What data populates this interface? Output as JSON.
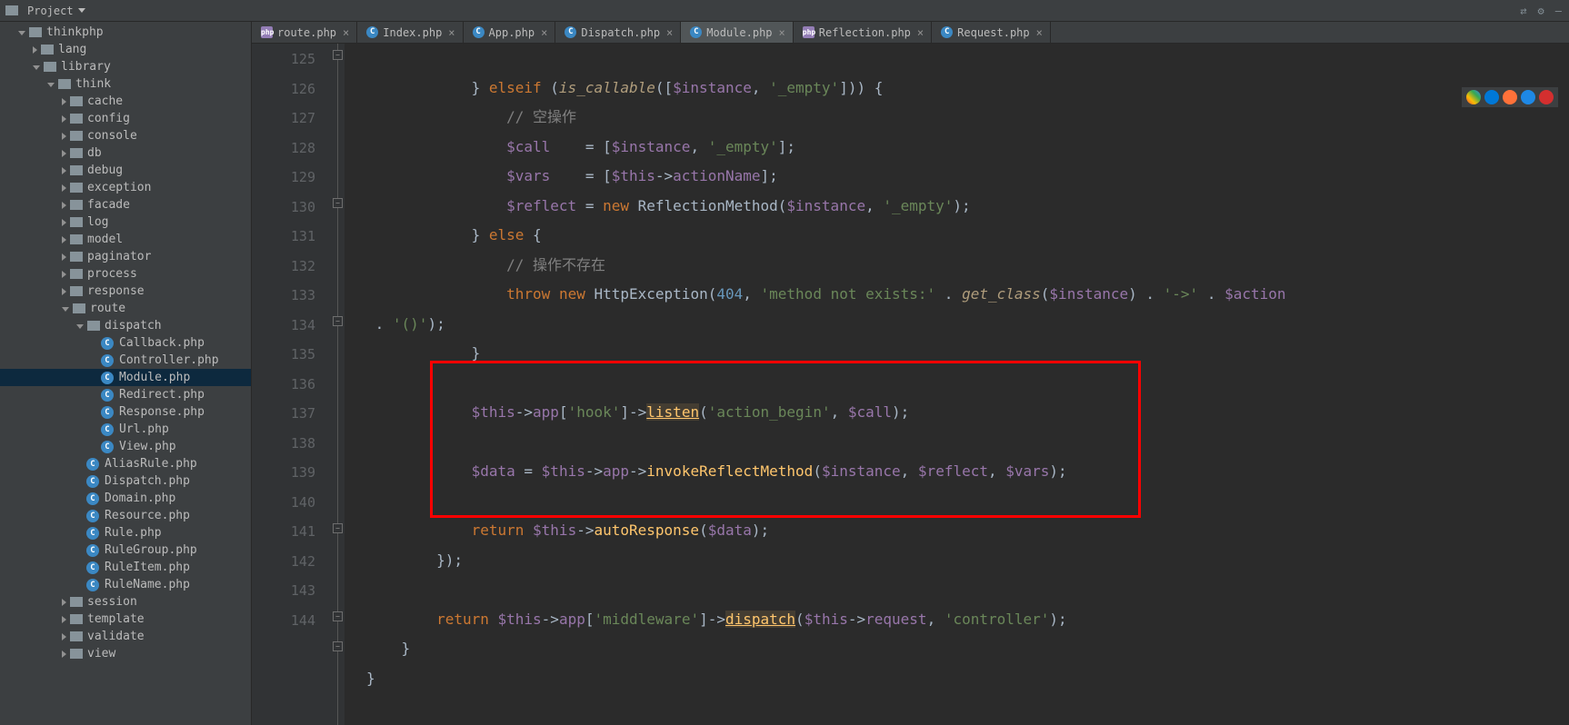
{
  "toolbar": {
    "project_label": "Project"
  },
  "tree": [
    {
      "depth": 1,
      "kind": "dir",
      "arrow": "open",
      "label": "thinkphp"
    },
    {
      "depth": 2,
      "kind": "dir",
      "arrow": "closed",
      "label": "lang"
    },
    {
      "depth": 2,
      "kind": "dir",
      "arrow": "open",
      "label": "library"
    },
    {
      "depth": 3,
      "kind": "dir",
      "arrow": "open",
      "label": "think"
    },
    {
      "depth": 4,
      "kind": "dir",
      "arrow": "closed",
      "label": "cache"
    },
    {
      "depth": 4,
      "kind": "dir",
      "arrow": "closed",
      "label": "config"
    },
    {
      "depth": 4,
      "kind": "dir",
      "arrow": "closed",
      "label": "console"
    },
    {
      "depth": 4,
      "kind": "dir",
      "arrow": "closed",
      "label": "db"
    },
    {
      "depth": 4,
      "kind": "dir",
      "arrow": "closed",
      "label": "debug"
    },
    {
      "depth": 4,
      "kind": "dir",
      "arrow": "closed",
      "label": "exception"
    },
    {
      "depth": 4,
      "kind": "dir",
      "arrow": "closed",
      "label": "facade"
    },
    {
      "depth": 4,
      "kind": "dir",
      "arrow": "closed",
      "label": "log"
    },
    {
      "depth": 4,
      "kind": "dir",
      "arrow": "closed",
      "label": "model"
    },
    {
      "depth": 4,
      "kind": "dir",
      "arrow": "closed",
      "label": "paginator"
    },
    {
      "depth": 4,
      "kind": "dir",
      "arrow": "closed",
      "label": "process"
    },
    {
      "depth": 4,
      "kind": "dir",
      "arrow": "closed",
      "label": "response"
    },
    {
      "depth": 4,
      "kind": "dir",
      "arrow": "open",
      "label": "route"
    },
    {
      "depth": 5,
      "kind": "dir",
      "arrow": "open",
      "label": "dispatch"
    },
    {
      "depth": 6,
      "kind": "file",
      "arrow": "none",
      "label": "Callback.php"
    },
    {
      "depth": 6,
      "kind": "file",
      "arrow": "none",
      "label": "Controller.php"
    },
    {
      "depth": 6,
      "kind": "file",
      "arrow": "none",
      "label": "Module.php",
      "selected": true
    },
    {
      "depth": 6,
      "kind": "file",
      "arrow": "none",
      "label": "Redirect.php"
    },
    {
      "depth": 6,
      "kind": "file",
      "arrow": "none",
      "label": "Response.php"
    },
    {
      "depth": 6,
      "kind": "file",
      "arrow": "none",
      "label": "Url.php"
    },
    {
      "depth": 6,
      "kind": "file",
      "arrow": "none",
      "label": "View.php"
    },
    {
      "depth": 5,
      "kind": "file",
      "arrow": "none",
      "label": "AliasRule.php"
    },
    {
      "depth": 5,
      "kind": "file",
      "arrow": "none",
      "label": "Dispatch.php"
    },
    {
      "depth": 5,
      "kind": "file",
      "arrow": "none",
      "label": "Domain.php"
    },
    {
      "depth": 5,
      "kind": "file",
      "arrow": "none",
      "label": "Resource.php"
    },
    {
      "depth": 5,
      "kind": "file",
      "arrow": "none",
      "label": "Rule.php"
    },
    {
      "depth": 5,
      "kind": "file",
      "arrow": "none",
      "label": "RuleGroup.php"
    },
    {
      "depth": 5,
      "kind": "file",
      "arrow": "none",
      "label": "RuleItem.php"
    },
    {
      "depth": 5,
      "kind": "file",
      "arrow": "none",
      "label": "RuleName.php"
    },
    {
      "depth": 4,
      "kind": "dir",
      "arrow": "closed",
      "label": "session"
    },
    {
      "depth": 4,
      "kind": "dir",
      "arrow": "closed",
      "label": "template"
    },
    {
      "depth": 4,
      "kind": "dir",
      "arrow": "closed",
      "label": "validate"
    },
    {
      "depth": 4,
      "kind": "dir",
      "arrow": "closed",
      "label": "view"
    }
  ],
  "tabs": [
    {
      "label": "route.php",
      "icon": "purple"
    },
    {
      "label": "Index.php",
      "icon": "c"
    },
    {
      "label": "App.php",
      "icon": "c"
    },
    {
      "label": "Dispatch.php",
      "icon": "c"
    },
    {
      "label": "Module.php",
      "icon": "c",
      "active": true
    },
    {
      "label": "Reflection.php",
      "icon": "purple"
    },
    {
      "label": "Request.php",
      "icon": "c"
    }
  ],
  "line_numbers": [
    "125",
    "126",
    "127",
    "128",
    "129",
    "130",
    "131",
    "132",
    "",
    "133",
    "134",
    "135",
    "136",
    "137",
    "138",
    "139",
    "140",
    "141",
    "142",
    "143",
    "144"
  ],
  "code": {
    "l125": "            } elseif (is_callable([$instance, '_empty'])) {",
    "l126": "                // 空操作",
    "l127": "                $call    = [$instance, '_empty'];",
    "l128": "                $vars    = [$this->actionName];",
    "l129": "                $reflect = new ReflectionMethod($instance, '_empty');",
    "l130": "            } else {",
    "l131": "                // 操作不存在",
    "l132": "                throw new HttpException(404, 'method not exists:' . get_class($instance) . '->' . $action",
    "l132b": " . '()');",
    "l133": "            }",
    "l135": "            $this->app['hook']->listen('action_begin', $call);",
    "l137": "            $data = $this->app->invokeReflectMethod($instance, $reflect, $vars);",
    "l139": "            return $this->autoResponse($data);",
    "l140": "        });",
    "l142": "        return $this->app['middleware']->dispatch($this->request, 'controller');",
    "l143": "    }",
    "l144": "}"
  },
  "browser_colors": [
    "#f44336",
    "#0090ff",
    "#ff6c00",
    "#1e88e5",
    "#d32f2f"
  ]
}
